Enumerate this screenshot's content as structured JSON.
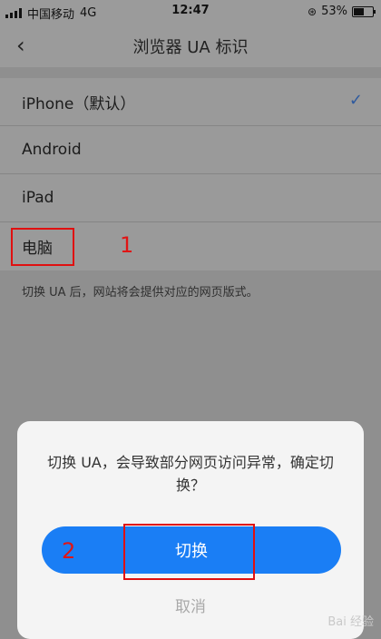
{
  "status_bar": {
    "carrier": "中国移动",
    "network": "4G",
    "time": "12:47",
    "battery": "53%",
    "battery_level": 0.53
  },
  "nav": {
    "back_icon": "chevron-left-icon",
    "title": "浏览器 UA 标识"
  },
  "options": [
    {
      "label": "iPhone（默认）",
      "selected": true
    },
    {
      "label": "Android",
      "selected": false
    },
    {
      "label": "iPad",
      "selected": false
    },
    {
      "label": "电脑",
      "selected": false
    }
  ],
  "check_mark": "✓",
  "hint": "切换 UA 后，网站将会提供对应的网页版式。",
  "annotations": {
    "step1": "1",
    "step2": "2"
  },
  "dialog": {
    "message": "切换 UA，会导致部分网页访问异常，确定切换？",
    "confirm_label": "切换",
    "cancel_label": "取消"
  },
  "watermark": "Bai 经验",
  "colors": {
    "accent": "#1a7ef5",
    "annotation": "#e01010"
  }
}
